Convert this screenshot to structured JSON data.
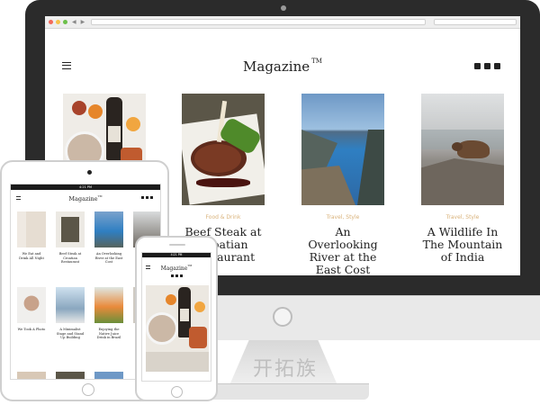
{
  "desktop": {
    "site_title": "Magazine",
    "trademark": "TM",
    "social_icons": [
      "twitter-icon",
      "facebook-icon",
      "instagram-icon"
    ],
    "articles": [
      {
        "category": "",
        "headline": ""
      },
      {
        "category": "Food & Drink",
        "headline": "Beef Steak at Croatian Restaurant"
      },
      {
        "category": "Travel, Style",
        "headline": "An Overlooking River at the East Cost"
      },
      {
        "category": "Travel, Style",
        "headline": "A Wildlife In The Mountain of India"
      }
    ]
  },
  "tablet": {
    "status_time": "4:21 PM",
    "site_title": "Magazine",
    "trademark": "TM",
    "articles_row1": [
      "We Eat and Drink All Night",
      "Beef Steak at Croatian Restaurant",
      "An Overlooking River at the East Cost",
      ""
    ],
    "articles_row2": [
      "We Took A Photo",
      "A Minimalist Stage and Stand Up Building",
      "Enjoying the Native Juice Drink in Brazil",
      ""
    ]
  },
  "phone": {
    "status_time": "4:21 PM",
    "site_title": "Magazine",
    "trademark": "TM"
  },
  "watermark": "开拓族",
  "colors": {
    "category": "#d9b27a",
    "frame": "#2b2b2b",
    "text": "#222222"
  }
}
